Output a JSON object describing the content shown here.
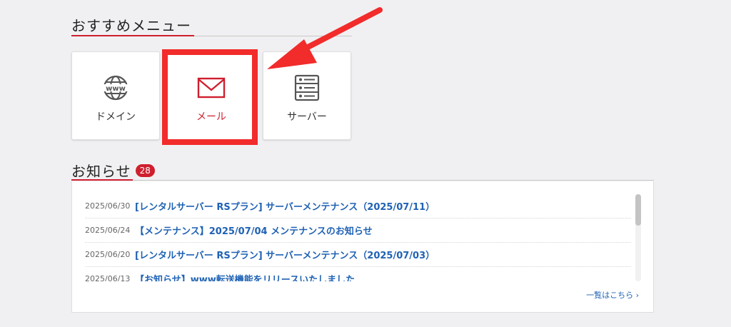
{
  "recommended": {
    "title": "おすすめメニュー",
    "items": [
      {
        "label": "ドメイン",
        "icon": "www-globe-icon"
      },
      {
        "label": "メール",
        "icon": "envelope-icon"
      },
      {
        "label": "サーバー",
        "icon": "server-icon"
      }
    ]
  },
  "news": {
    "title": "お知らせ",
    "count": "28",
    "items": [
      {
        "date": "2025/06/30",
        "title": "[レンタルサーバー RSプラン] サーバーメンテナンス（2025/07/11）"
      },
      {
        "date": "2025/06/24",
        "title": "【メンテナンス】2025/07/04 メンテナンスのお知らせ"
      },
      {
        "date": "2025/06/20",
        "title": "[レンタルサーバー RSプラン] サーバーメンテナンス（2025/07/03）"
      },
      {
        "date": "2025/06/13",
        "title": "【お知らせ】www転送機能をリリースいたしました"
      }
    ],
    "more_label": "一覧はこちら ›"
  },
  "colors": {
    "accent": "#cf1f2e",
    "link": "#1f62b4",
    "highlight": "#f22b2b"
  }
}
